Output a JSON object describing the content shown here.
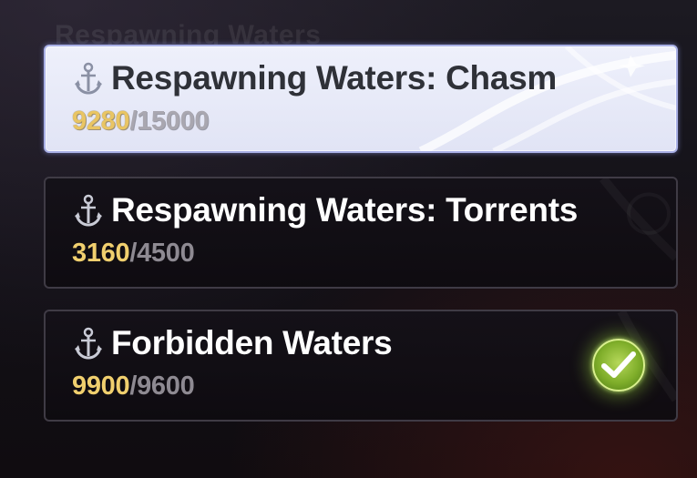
{
  "header": {
    "faded_title": "Respawning Waters"
  },
  "quests": [
    {
      "title": "Respawning Waters: Chasm",
      "current": "9280",
      "total": "15000",
      "separator": "/",
      "state": "selected",
      "completed": false,
      "icon": "anchor-icon"
    },
    {
      "title": "Respawning Waters: Torrents",
      "current": "3160",
      "total": "4500",
      "separator": "/",
      "state": "normal",
      "completed": false,
      "icon": "anchor-icon"
    },
    {
      "title": "Forbidden Waters",
      "current": "9900",
      "total": "9600",
      "separator": "/",
      "state": "normal",
      "completed": true,
      "icon": "anchor-icon",
      "badge_icon": "checkmark-icon"
    }
  ],
  "colors": {
    "current_value": "#f0cf6e",
    "total_value": "#8e8a92",
    "selected_bg": "#e6e9f8",
    "selected_border": "#a9b0e6",
    "complete_badge": "#8fc03a"
  }
}
